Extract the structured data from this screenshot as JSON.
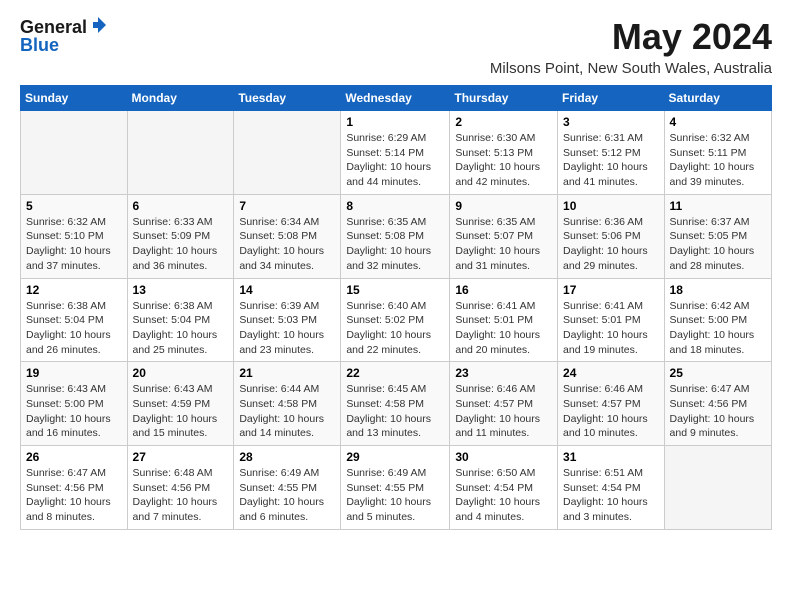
{
  "logo": {
    "general": "General",
    "blue": "Blue"
  },
  "title": "May 2024",
  "location": "Milsons Point, New South Wales, Australia",
  "weekdays": [
    "Sunday",
    "Monday",
    "Tuesday",
    "Wednesday",
    "Thursday",
    "Friday",
    "Saturday"
  ],
  "weeks": [
    [
      {
        "day": "",
        "info": ""
      },
      {
        "day": "",
        "info": ""
      },
      {
        "day": "",
        "info": ""
      },
      {
        "day": "1",
        "info": "Sunrise: 6:29 AM\nSunset: 5:14 PM\nDaylight: 10 hours\nand 44 minutes."
      },
      {
        "day": "2",
        "info": "Sunrise: 6:30 AM\nSunset: 5:13 PM\nDaylight: 10 hours\nand 42 minutes."
      },
      {
        "day": "3",
        "info": "Sunrise: 6:31 AM\nSunset: 5:12 PM\nDaylight: 10 hours\nand 41 minutes."
      },
      {
        "day": "4",
        "info": "Sunrise: 6:32 AM\nSunset: 5:11 PM\nDaylight: 10 hours\nand 39 minutes."
      }
    ],
    [
      {
        "day": "5",
        "info": "Sunrise: 6:32 AM\nSunset: 5:10 PM\nDaylight: 10 hours\nand 37 minutes."
      },
      {
        "day": "6",
        "info": "Sunrise: 6:33 AM\nSunset: 5:09 PM\nDaylight: 10 hours\nand 36 minutes."
      },
      {
        "day": "7",
        "info": "Sunrise: 6:34 AM\nSunset: 5:08 PM\nDaylight: 10 hours\nand 34 minutes."
      },
      {
        "day": "8",
        "info": "Sunrise: 6:35 AM\nSunset: 5:08 PM\nDaylight: 10 hours\nand 32 minutes."
      },
      {
        "day": "9",
        "info": "Sunrise: 6:35 AM\nSunset: 5:07 PM\nDaylight: 10 hours\nand 31 minutes."
      },
      {
        "day": "10",
        "info": "Sunrise: 6:36 AM\nSunset: 5:06 PM\nDaylight: 10 hours\nand 29 minutes."
      },
      {
        "day": "11",
        "info": "Sunrise: 6:37 AM\nSunset: 5:05 PM\nDaylight: 10 hours\nand 28 minutes."
      }
    ],
    [
      {
        "day": "12",
        "info": "Sunrise: 6:38 AM\nSunset: 5:04 PM\nDaylight: 10 hours\nand 26 minutes."
      },
      {
        "day": "13",
        "info": "Sunrise: 6:38 AM\nSunset: 5:04 PM\nDaylight: 10 hours\nand 25 minutes."
      },
      {
        "day": "14",
        "info": "Sunrise: 6:39 AM\nSunset: 5:03 PM\nDaylight: 10 hours\nand 23 minutes."
      },
      {
        "day": "15",
        "info": "Sunrise: 6:40 AM\nSunset: 5:02 PM\nDaylight: 10 hours\nand 22 minutes."
      },
      {
        "day": "16",
        "info": "Sunrise: 6:41 AM\nSunset: 5:01 PM\nDaylight: 10 hours\nand 20 minutes."
      },
      {
        "day": "17",
        "info": "Sunrise: 6:41 AM\nSunset: 5:01 PM\nDaylight: 10 hours\nand 19 minutes."
      },
      {
        "day": "18",
        "info": "Sunrise: 6:42 AM\nSunset: 5:00 PM\nDaylight: 10 hours\nand 18 minutes."
      }
    ],
    [
      {
        "day": "19",
        "info": "Sunrise: 6:43 AM\nSunset: 5:00 PM\nDaylight: 10 hours\nand 16 minutes."
      },
      {
        "day": "20",
        "info": "Sunrise: 6:43 AM\nSunset: 4:59 PM\nDaylight: 10 hours\nand 15 minutes."
      },
      {
        "day": "21",
        "info": "Sunrise: 6:44 AM\nSunset: 4:58 PM\nDaylight: 10 hours\nand 14 minutes."
      },
      {
        "day": "22",
        "info": "Sunrise: 6:45 AM\nSunset: 4:58 PM\nDaylight: 10 hours\nand 13 minutes."
      },
      {
        "day": "23",
        "info": "Sunrise: 6:46 AM\nSunset: 4:57 PM\nDaylight: 10 hours\nand 11 minutes."
      },
      {
        "day": "24",
        "info": "Sunrise: 6:46 AM\nSunset: 4:57 PM\nDaylight: 10 hours\nand 10 minutes."
      },
      {
        "day": "25",
        "info": "Sunrise: 6:47 AM\nSunset: 4:56 PM\nDaylight: 10 hours\nand 9 minutes."
      }
    ],
    [
      {
        "day": "26",
        "info": "Sunrise: 6:47 AM\nSunset: 4:56 PM\nDaylight: 10 hours\nand 8 minutes."
      },
      {
        "day": "27",
        "info": "Sunrise: 6:48 AM\nSunset: 4:56 PM\nDaylight: 10 hours\nand 7 minutes."
      },
      {
        "day": "28",
        "info": "Sunrise: 6:49 AM\nSunset: 4:55 PM\nDaylight: 10 hours\nand 6 minutes."
      },
      {
        "day": "29",
        "info": "Sunrise: 6:49 AM\nSunset: 4:55 PM\nDaylight: 10 hours\nand 5 minutes."
      },
      {
        "day": "30",
        "info": "Sunrise: 6:50 AM\nSunset: 4:54 PM\nDaylight: 10 hours\nand 4 minutes."
      },
      {
        "day": "31",
        "info": "Sunrise: 6:51 AM\nSunset: 4:54 PM\nDaylight: 10 hours\nand 3 minutes."
      },
      {
        "day": "",
        "info": ""
      }
    ]
  ]
}
